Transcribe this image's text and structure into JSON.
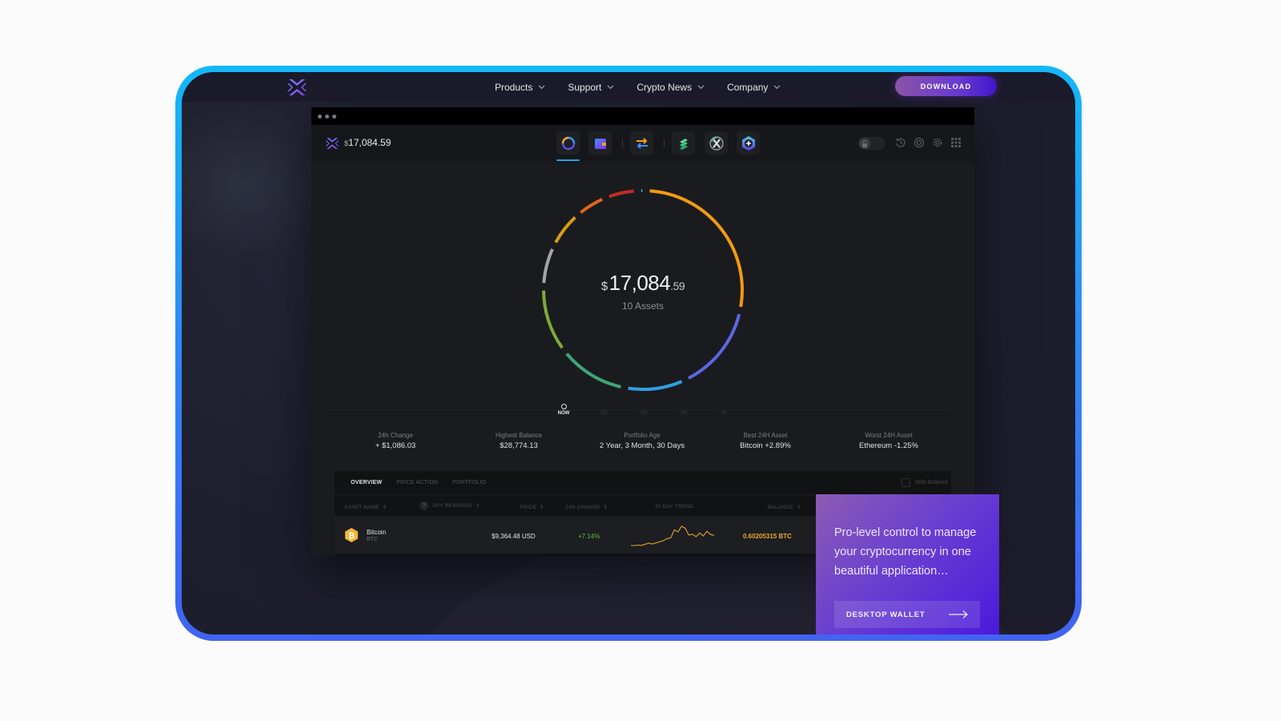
{
  "nav": {
    "logo": "exodus-logo",
    "links": [
      {
        "label": "Products"
      },
      {
        "label": "Support"
      },
      {
        "label": "Crypto News"
      },
      {
        "label": "Company"
      }
    ],
    "download_label": "DOWNLOAD"
  },
  "app": {
    "header": {
      "currency_symbol": "$",
      "balance": "17,084.59",
      "app_icons": [
        "portfolio-icon",
        "wallet-icon",
        "exchange-icon",
        "compound-icon",
        "xswap-icon",
        "add-app-icon"
      ],
      "right_tools": [
        "lock-toggle",
        "history-icon",
        "support-icon",
        "settings-icon",
        "apps-grid-icon"
      ]
    },
    "portfolio": {
      "currency_symbol": "$",
      "amount_whole": "17,084",
      "amount_cents": ".59",
      "assets_label": "10 Assets",
      "segments": [
        {
          "color": "#f39a12",
          "share": 0.265
        },
        {
          "color": "#5a67e6",
          "share": 0.14
        },
        {
          "color": "#2f9fe6",
          "share": 0.095
        },
        {
          "color": "#3fa577",
          "share": 0.11
        },
        {
          "color": "#7bab37",
          "share": 0.105
        },
        {
          "color": "#a4a4a8",
          "share": 0.065
        },
        {
          "color": "#d59c14",
          "share": 0.06
        },
        {
          "color": "#e1651a",
          "share": 0.05
        },
        {
          "color": "#c42c28",
          "share": 0.05
        },
        {
          "color": "#3fb6c6",
          "share": 0.013
        }
      ]
    },
    "time_ranges": [
      {
        "label": "NOW",
        "active": true
      },
      {
        "label": "1D"
      },
      {
        "label": "1W"
      },
      {
        "label": "1M"
      },
      {
        "label": "All"
      }
    ],
    "stats": [
      {
        "label": "24h Change",
        "value": "+ $1,086.03"
      },
      {
        "label": "Highest Balance",
        "value": "$28,774.13"
      },
      {
        "label": "Portfolio Age",
        "value": "2 Year, 3 Month, 30 Days"
      },
      {
        "label": "Best 24H Asset",
        "value": "Bitcoin +2.89%"
      },
      {
        "label": "Worst 24H Asset",
        "value": "Ethereum -1.25%"
      }
    ],
    "table": {
      "tabs": [
        "OVERVIEW",
        "PRICE ACTION",
        "PORTFOLIO"
      ],
      "with_balance_label": "With Balance",
      "with_balance_checked": false,
      "columns": [
        "ASSET NAME",
        "APY REWARDS",
        "PRICE",
        "24H CHANGE",
        "30 DAY TREND",
        "BALANCE"
      ],
      "rows": [
        {
          "name": "Bitcoin",
          "symbol": "BTC",
          "price": "$9,364.48 USD",
          "change": "+7.14%",
          "balance": "0.60205315 BTC",
          "trend": [
            2,
            2,
            2.3,
            2.1,
            3,
            3.6,
            3.1,
            3.9,
            4.6,
            5.4,
            6.8,
            7.2,
            12.8,
            11.4,
            15.2,
            14.0,
            9.2,
            9.8,
            8.1,
            10.6,
            8.6,
            11.8,
            9.6,
            9.0
          ]
        }
      ]
    }
  },
  "promo": {
    "text": "Pro-level control to manage your cryptocurrency in one beautiful application…",
    "button_label": "DESKTOP WALLET"
  }
}
